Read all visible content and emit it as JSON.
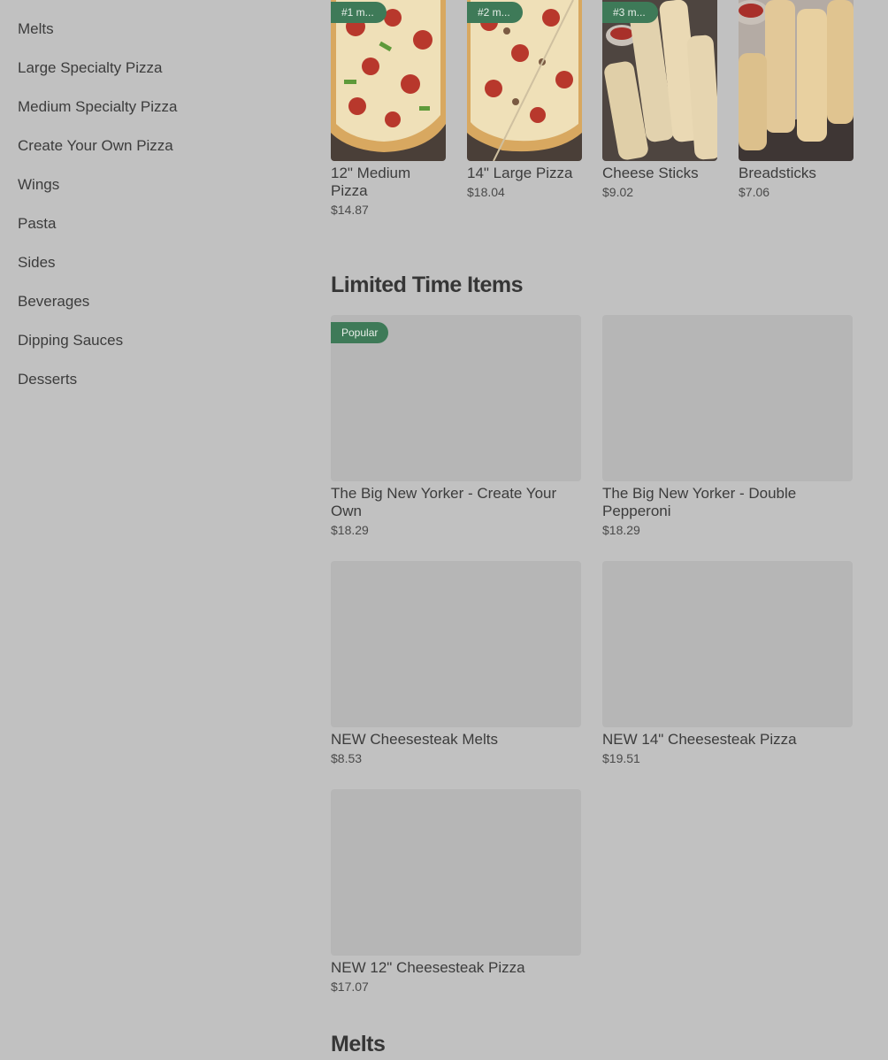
{
  "sidebar": {
    "items": [
      {
        "label": "Melts"
      },
      {
        "label": "Large Specialty Pizza"
      },
      {
        "label": "Medium Specialty Pizza"
      },
      {
        "label": "Create Your Own Pizza"
      },
      {
        "label": "Wings"
      },
      {
        "label": "Pasta"
      },
      {
        "label": "Sides"
      },
      {
        "label": "Beverages"
      },
      {
        "label": "Dipping Sauces"
      },
      {
        "label": "Desserts"
      }
    ]
  },
  "popular": {
    "items": [
      {
        "rank": "#1 m...",
        "name": "12\" Medium Pizza",
        "price": "$14.87"
      },
      {
        "rank": "#2 m...",
        "name": "14\" Large Pizza",
        "price": "$18.04"
      },
      {
        "rank": "#3 m...",
        "name": "Cheese Sticks",
        "price": "$9.02"
      },
      {
        "name": "Breadsticks",
        "price": "$7.06"
      }
    ]
  },
  "limited": {
    "title": "Limited Time Items",
    "badge": "Popular",
    "items": [
      {
        "name": "The Big New Yorker - Create Your Own",
        "price": "$18.29"
      },
      {
        "name": "The Big New Yorker - Double Pepperoni",
        "price": "$18.29"
      },
      {
        "name": "NEW Cheesesteak Melts",
        "price": "$8.53"
      },
      {
        "name": "NEW 14\" Cheesesteak Pizza",
        "price": "$19.51"
      },
      {
        "name": "NEW 12\" Cheesesteak Pizza",
        "price": "$17.07"
      }
    ]
  },
  "melts": {
    "title": "Melts"
  },
  "colors": {
    "background": "#c1c1c1",
    "badge": "#3e7a58",
    "placeholder": "#b6b6b6"
  }
}
